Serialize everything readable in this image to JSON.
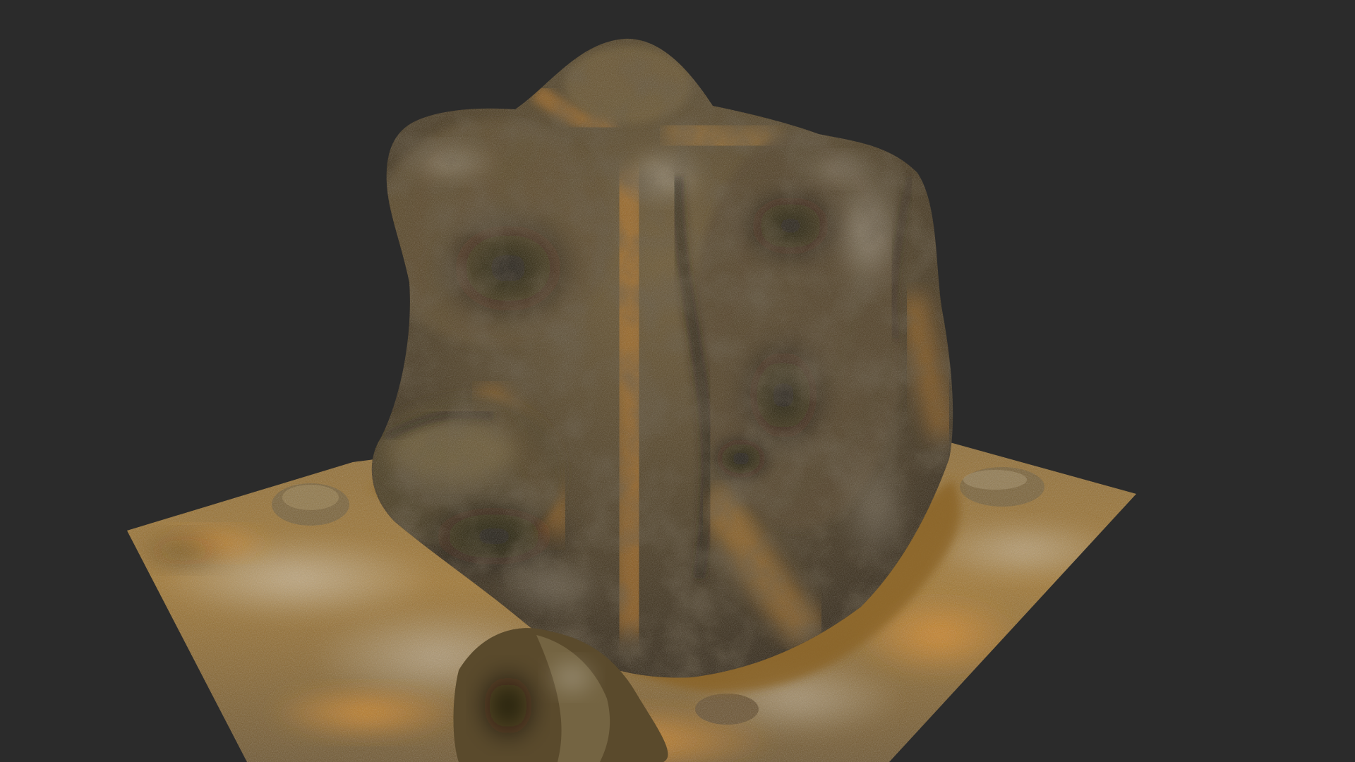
{
  "viewport": {
    "background_color": "#2b2b2b"
  },
  "model": {
    "subject": "rock-formation",
    "palette": {
      "ochre": "#c07a22",
      "ochre_light": "#d8953a",
      "rock_dark": "#2f2618",
      "rock_mid": "#5a4a2e",
      "rock_light": "#8a7a5a",
      "lichen_white": "#cfc8bb",
      "moss": "#6b5a2a"
    }
  }
}
